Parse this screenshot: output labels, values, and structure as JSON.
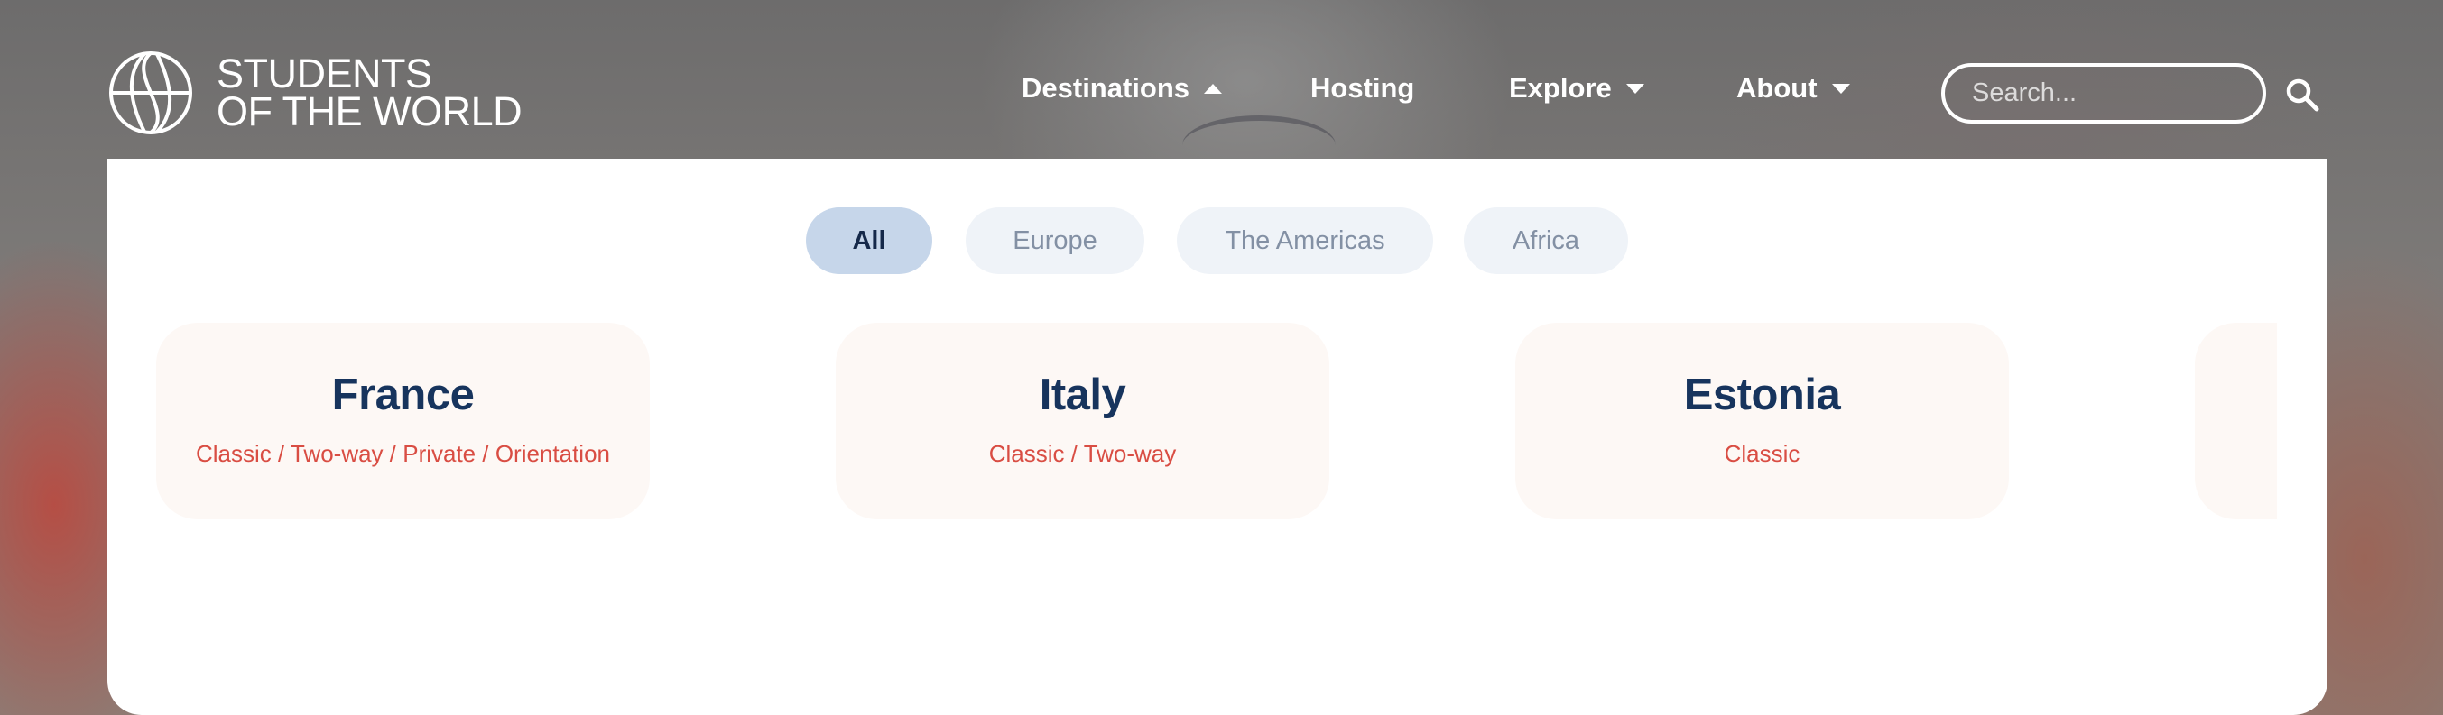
{
  "brand": {
    "line1": "STUDENTS",
    "line2": "OF THE WORLD",
    "logo_icon": "globe-icon"
  },
  "nav": {
    "destinations": "Destinations",
    "hosting": "Hosting",
    "explore": "Explore",
    "about": "About"
  },
  "search": {
    "placeholder": "Search...",
    "icon": "search-icon"
  },
  "filters": [
    "All",
    "Europe",
    "The Americas",
    "Africa"
  ],
  "active_filter": "All",
  "destinations": [
    {
      "name": "France",
      "programs": "Classic / Two-way / Private / Orientation"
    },
    {
      "name": "Italy",
      "programs": "Classic / Two-way"
    },
    {
      "name": "Estonia",
      "programs": "Classic"
    }
  ],
  "colors": {
    "title": "#17345d",
    "programs": "#d94d43",
    "active_chip": "#c6d6ea",
    "chip": "#eff3f8",
    "card": "#fdf8f5"
  }
}
